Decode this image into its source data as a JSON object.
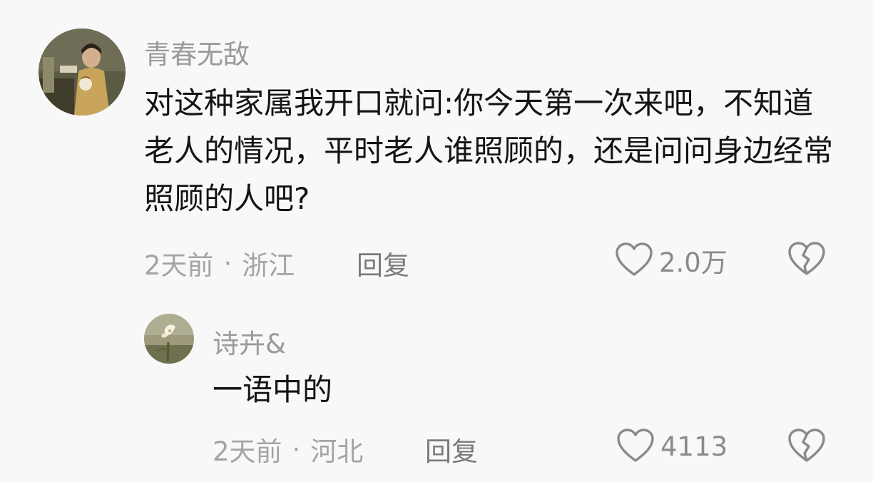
{
  "comments": [
    {
      "username": "青春无敌",
      "body": "对这种家属我开口就问:你今天第一次来吧，不知道老人的情况，平时老人谁照顾的，还是问问身边经常照顾的人吧?",
      "time": "2天前",
      "separator": "·",
      "location": "浙江",
      "reply_label": "回复",
      "likes": "2.0万",
      "avatar_icon": "avatar-woman-qipao",
      "like_icon": "heart-outline-icon",
      "dislike_icon": "broken-heart-icon"
    },
    {
      "username": "诗卉&",
      "body": "一语中的",
      "time": "2天前",
      "separator": "·",
      "location": "河北",
      "reply_label": "回复",
      "likes": "4113",
      "avatar_icon": "avatar-lily-flower",
      "like_icon": "heart-outline-icon",
      "dislike_icon": "broken-heart-icon"
    }
  ],
  "colors": {
    "background": "#f8f8f8",
    "text": "#141414",
    "muted": "#a4a4a4",
    "icon": "#8a8a8a"
  }
}
